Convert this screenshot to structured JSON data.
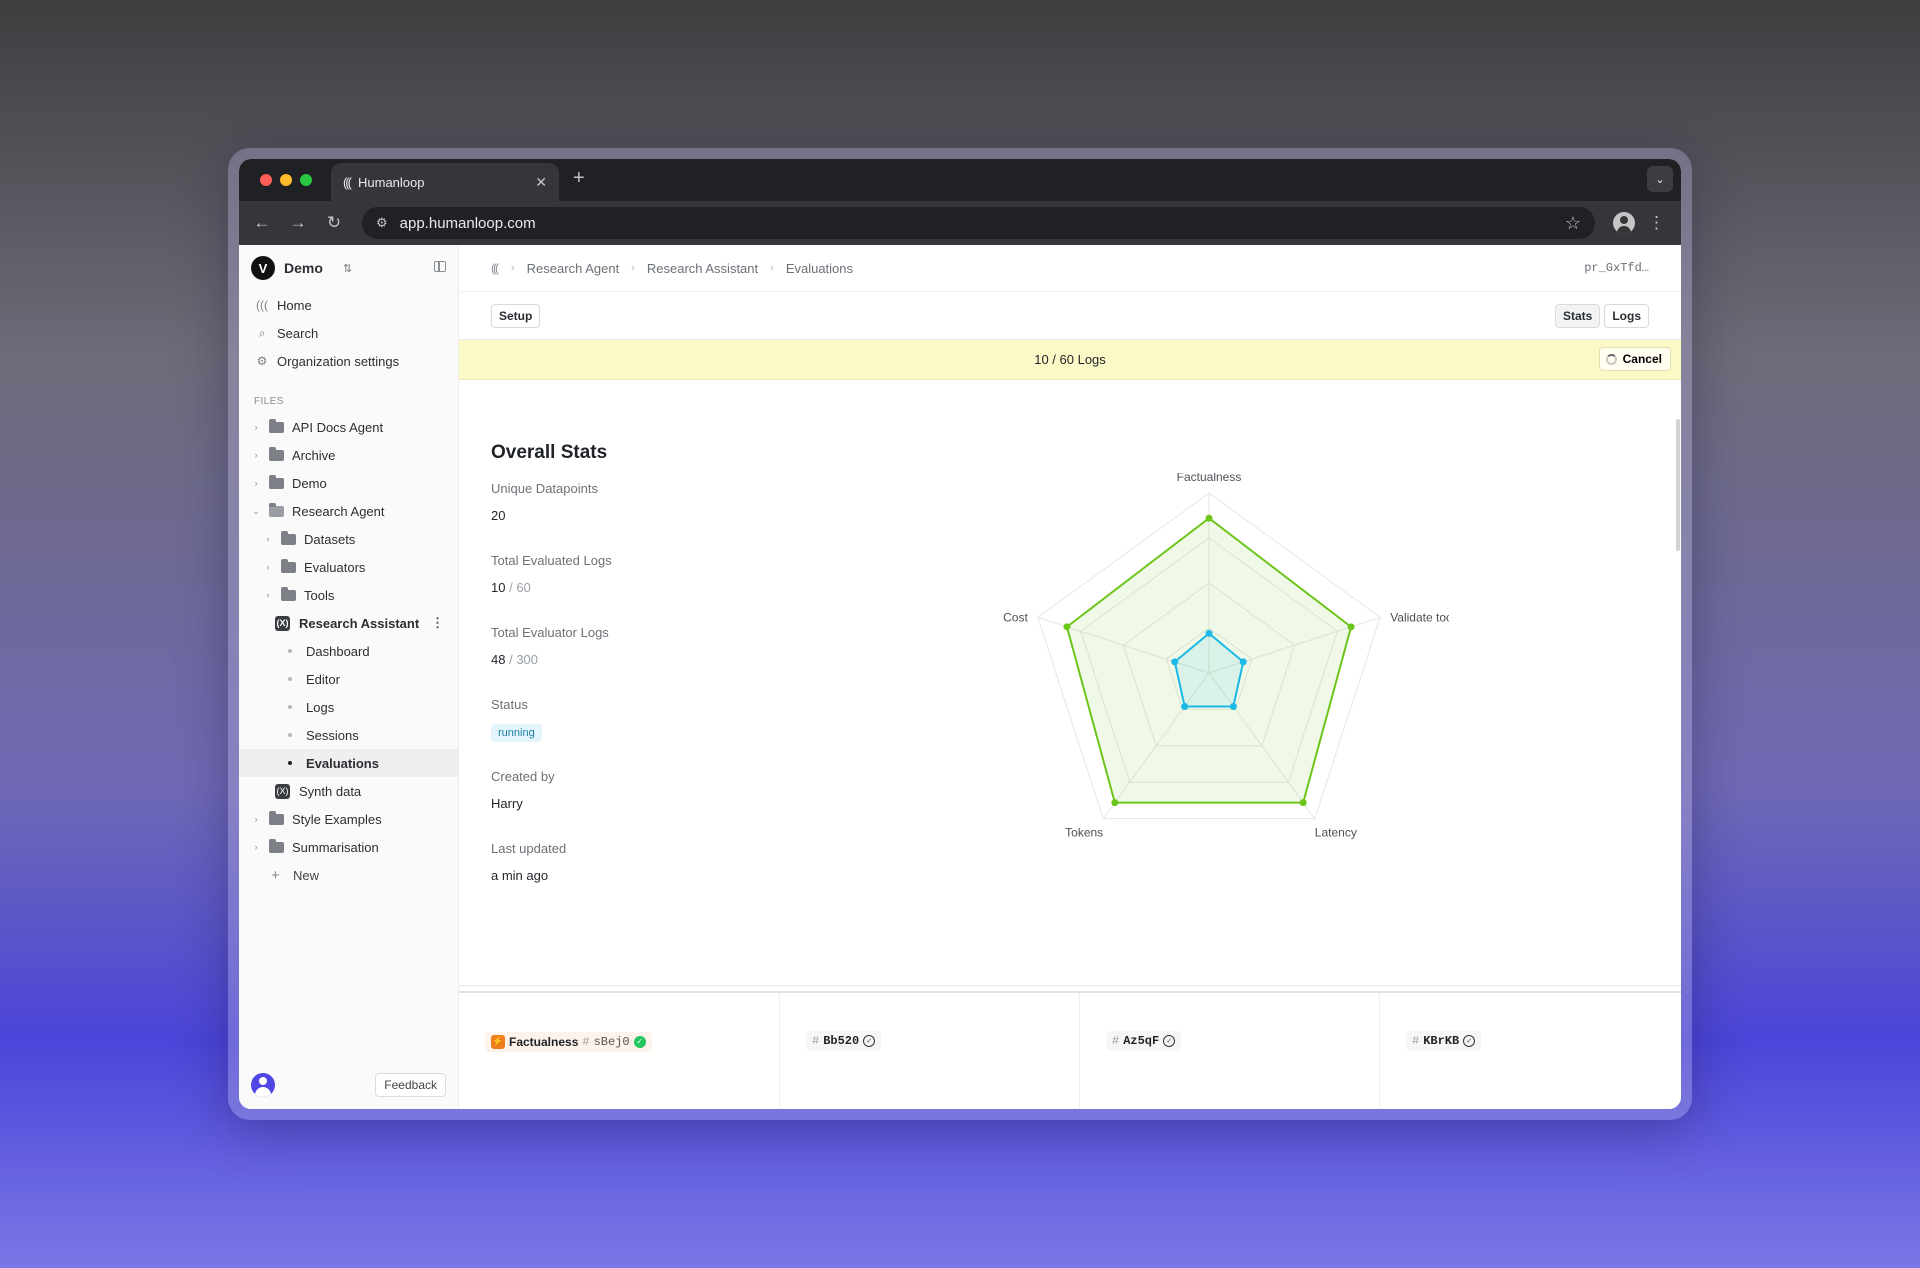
{
  "browser": {
    "tab_title": "Humanloop",
    "url": "app.humanloop.com"
  },
  "workspace": {
    "name": "Demo"
  },
  "nav": [
    {
      "label": "Home",
      "icon": "humanloop-icon"
    },
    {
      "label": "Search",
      "icon": "search-icon"
    },
    {
      "label": "Organization settings",
      "icon": "gear-icon"
    }
  ],
  "files_label": "FILES",
  "tree": {
    "api_docs": "API Docs Agent",
    "archive": "Archive",
    "demo": "Demo",
    "research_agent": "Research Agent",
    "datasets": "Datasets",
    "evaluators": "Evaluators",
    "tools": "Tools",
    "research_assistant": "Research Assistant",
    "dashboard": "Dashboard",
    "editor": "Editor",
    "logs": "Logs",
    "sessions": "Sessions",
    "evaluations": "Evaluations",
    "synth_data": "Synth data",
    "style_examples": "Style Examples",
    "summarisation": "Summarisation",
    "new": "New"
  },
  "feedback_label": "Feedback",
  "breadcrumb": {
    "items": [
      "Research Agent",
      "Research Assistant",
      "Evaluations"
    ],
    "id": "pr_GxTfd…"
  },
  "actions": {
    "setup": "Setup",
    "stats": "Stats",
    "logs": "Logs"
  },
  "progress": {
    "text": "10 / 60 Logs",
    "cancel": "Cancel"
  },
  "stats": {
    "title": "Overall Stats",
    "unique_datapoints_label": "Unique Datapoints",
    "unique_datapoints": "20",
    "evaluated_logs_label": "Total Evaluated Logs",
    "evaluated_logs": "10",
    "evaluated_logs_total": "/ 60",
    "evaluator_logs_label": "Total Evaluator Logs",
    "evaluator_logs": "48",
    "evaluator_logs_total": "/ 300",
    "status_label": "Status",
    "status": "running",
    "created_by_label": "Created by",
    "created_by": "Harry",
    "last_updated_label": "Last updated",
    "last_updated": "a min ago"
  },
  "chart_data": {
    "type": "radar",
    "axes": [
      "Factualness",
      "Validate tool",
      "Latency",
      "Tokens",
      "Cost"
    ],
    "rings": 4,
    "series": [
      {
        "values": [
          0.86,
          0.83,
          0.89,
          0.89,
          0.83
        ],
        "color": "#6cc51a"
      },
      {
        "values": [
          0.22,
          0.2,
          0.23,
          0.23,
          0.2
        ],
        "color": "#1ab9e6"
      }
    ]
  },
  "evaluators": [
    {
      "name": "Factualness",
      "id": "sBej0",
      "status": "complete"
    },
    {
      "name": "",
      "id": "Bb520",
      "status": "check"
    },
    {
      "name": "",
      "id": "Az5qF",
      "status": "check"
    },
    {
      "name": "",
      "id": "KBrKB",
      "status": "check"
    }
  ]
}
